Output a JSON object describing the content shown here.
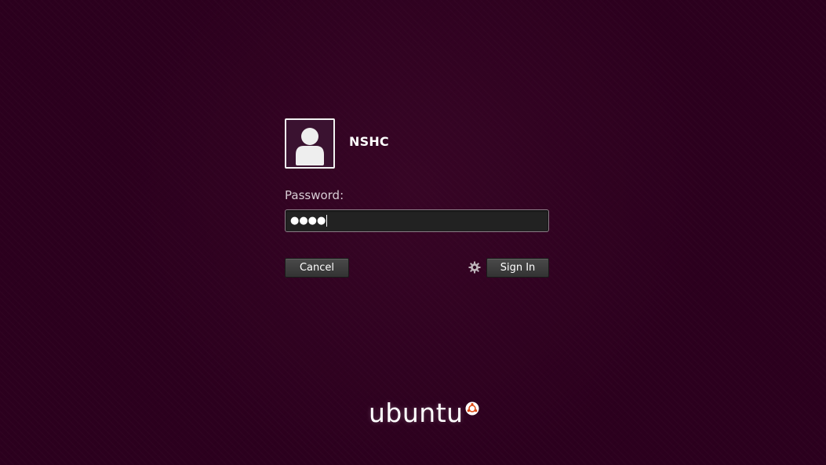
{
  "user": {
    "name": "NSHC"
  },
  "password": {
    "label": "Password:",
    "masked_value": "●●●●"
  },
  "buttons": {
    "cancel_label": "Cancel",
    "signin_label": "Sign In"
  },
  "branding": {
    "wordmark": "ubuntu"
  },
  "icons": {
    "avatar": "user-silhouette-icon",
    "session": "gear-icon",
    "logo_mark": "circle-of-friends-icon"
  },
  "colors": {
    "background": "#2c001e",
    "brand_orange": "#dd4814",
    "field_background": "#222222"
  }
}
